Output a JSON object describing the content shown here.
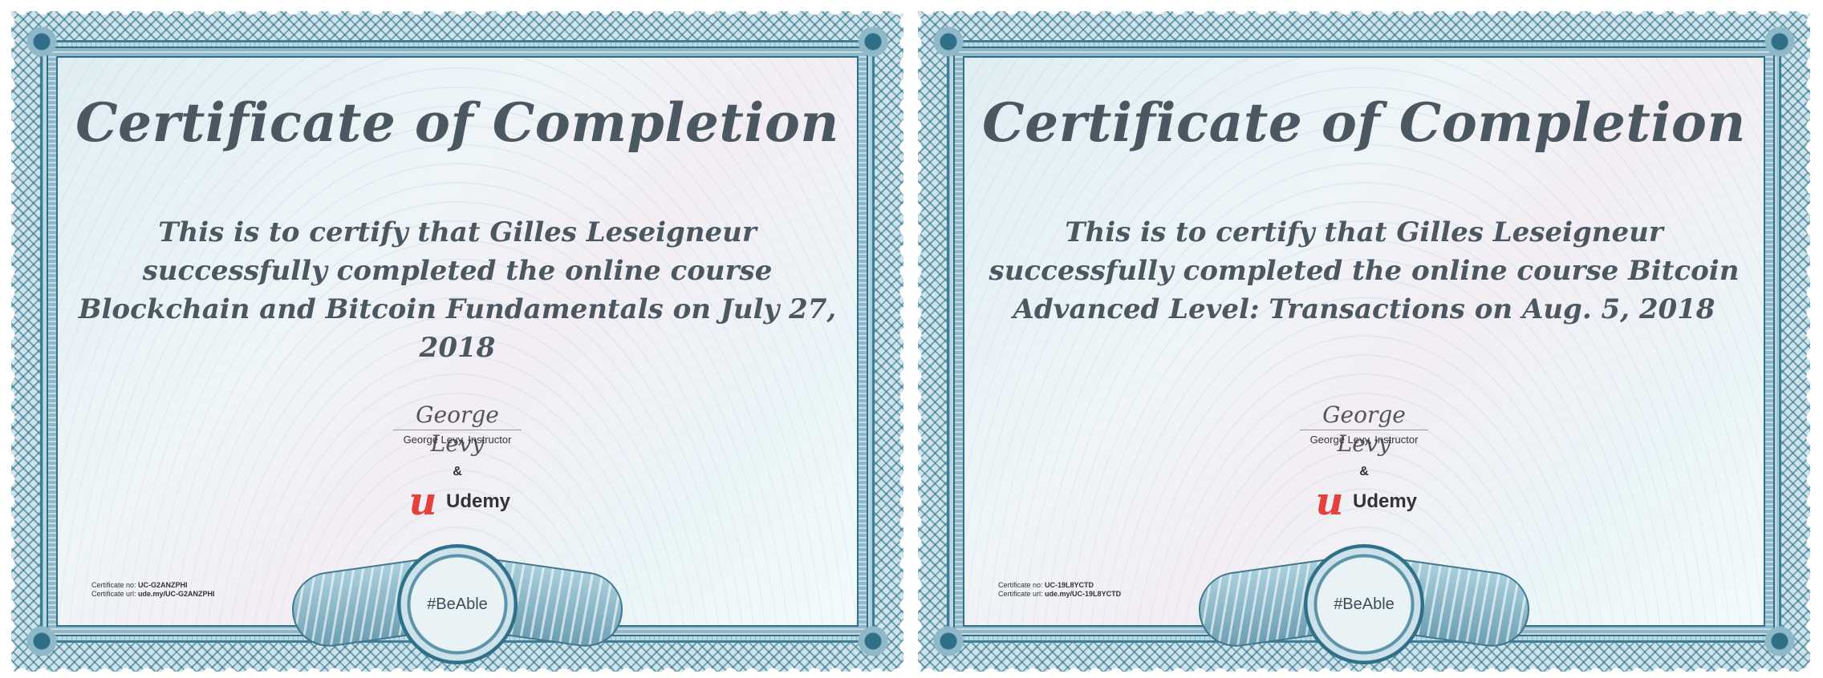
{
  "certificates": [
    {
      "title": "Certificate of Completion",
      "body": "This is to certify that Gilles Leseigneur successfully completed the online course Blockchain and Bitcoin Fundamentals on July 27, 2018",
      "signature_script": "George Levy",
      "signature_caption": "George Levy, Instructor",
      "ampersand": "&",
      "brand_logo": "u",
      "brand_name": "Udemy",
      "cert_no_label": "Certificate no:",
      "cert_no": "UC-G2ANZPHI",
      "cert_url_label": "Certificate url:",
      "cert_url": "ude.my/UC-G2ANZPHI",
      "seal_text": "#BeAble"
    },
    {
      "title": "Certificate of Completion",
      "body": "This is to certify that Gilles Leseigneur successfully completed the online course Bitcoin Advanced Level: Transactions on Aug. 5, 2018",
      "signature_script": "George Levy",
      "signature_caption": "George Levy, Instructor",
      "ampersand": "&",
      "brand_logo": "u",
      "brand_name": "Udemy",
      "cert_no_label": "Certificate no:",
      "cert_no": "UC-19L8YCTD",
      "cert_url_label": "Certificate url:",
      "cert_url": "ude.my/UC-19L8YCTD",
      "seal_text": "#BeAble"
    }
  ],
  "colors": {
    "border": "#2f6f88",
    "title_text": "#4b5862",
    "brand_red": "#e5403b"
  }
}
